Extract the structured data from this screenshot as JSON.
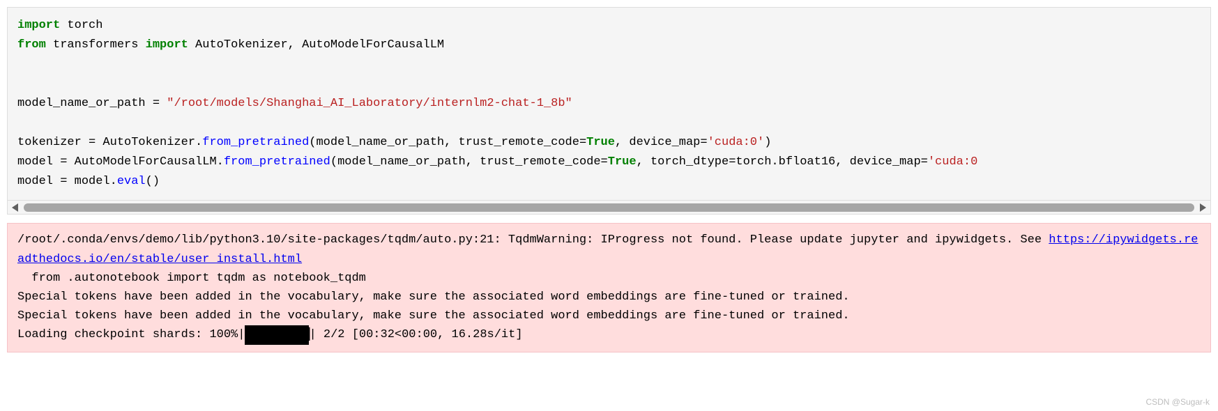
{
  "code": {
    "l1_kw1": "import",
    "l1_t1": " torch",
    "l2_kw1": "from",
    "l2_t1": " transformers ",
    "l2_kw2": "import",
    "l2_t2": " AutoTokenizer, AutoModelForCausalLM",
    "l3_t1": "model_name_or_path = ",
    "l3_str": "\"/root/models/Shanghai_AI_Laboratory/internlm2-chat-1_8b\"",
    "l4_t1": "tokenizer = AutoTokenizer.",
    "l4_fn": "from_pretrained",
    "l4_t2": "(model_name_or_path, trust_remote_code=",
    "l4_bool": "True",
    "l4_t3": ", device_map=",
    "l4_str": "'cuda:0'",
    "l4_t4": ")",
    "l5_t1": "model = AutoModelForCausalLM.",
    "l5_fn": "from_pretrained",
    "l5_t2": "(model_name_or_path, trust_remote_code=",
    "l5_bool": "True",
    "l5_t3": ", torch_dtype=torch.bfloat16, device_map=",
    "l5_str": "'cuda:0",
    "l6_t1": "model = model.",
    "l6_fn": "eval",
    "l6_t2": "()"
  },
  "output": {
    "warn1_a": "/root/.conda/envs/demo/lib/python3.10/site-packages/tqdm/auto.py:21: TqdmWarning: IProgress not found. Please update jupyter and ipywidgets. See ",
    "warn1_link": "https://ipywidgets.readthedocs.io/en/stable/user_install.html",
    "warn1_b": "  from .autonotebook import tqdm as notebook_tqdm",
    "warn2": "Special tokens have been added in the vocabulary, make sure the associated word embeddings are fine-tuned or trained.",
    "warn3": "Special tokens have been added in the vocabulary, make sure the associated word embeddings are fine-tuned or trained.",
    "progress_a": "Loading checkpoint shards: 100%|",
    "progress_bar": "██████████",
    "progress_b": "| 2/2 [00:32<00:00, 16.28s/it]"
  },
  "watermark": "CSDN @Sugar-k"
}
